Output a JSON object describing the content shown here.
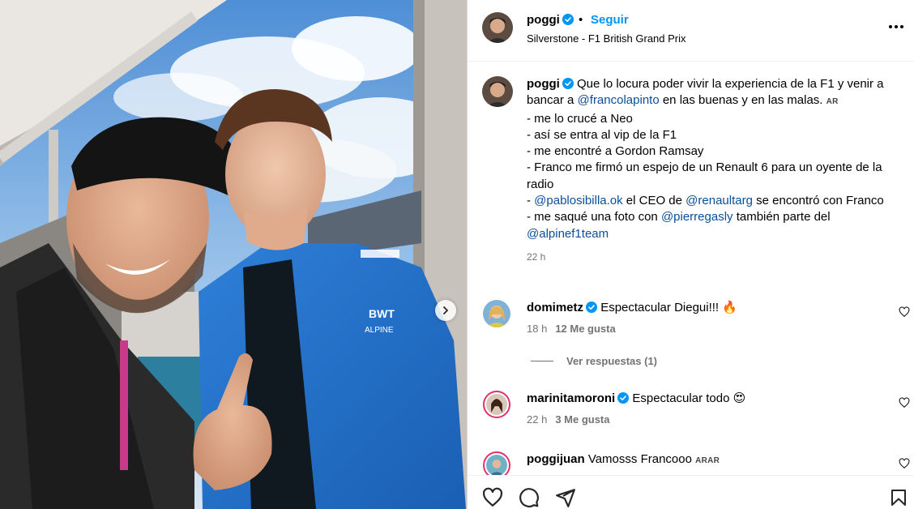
{
  "header": {
    "username": "poggi",
    "follow_label": "Seguir",
    "location": "Silverstone - F1 British Grand Prix",
    "dot": "•"
  },
  "caption": {
    "username": "poggi",
    "line1": "Que lo locura poder vivir la experiencia de la F1 y venir a bancar a ",
    "mention1": "@francolapinto",
    "line1b": " en las buenas y en las malas. ",
    "flag1": "AR",
    "items": [
      "- me lo crucé a Neo",
      "- así se entra al vip de la F1",
      "- me encontré a Gordon Ramsay",
      "- Franco me firmó un espejo de un Renault 6 para un oyente de la radio"
    ],
    "l5_pre": "- ",
    "mention2": "@pablosibilla.ok",
    "l5_mid": " el CEO de ",
    "mention3": "@renaultarg",
    "l5_post": " se encontró con Franco",
    "l6_pre": "- me saqué una foto con ",
    "mention4": "@pierregasly",
    "l6_mid": " también parte del ",
    "mention5": "@alpinef1team",
    "time": "22 h"
  },
  "comments": [
    {
      "username": "domimetz",
      "text": "Espectacular Diegui!!! 🔥",
      "time": "18 h",
      "likes": "12 Me gusta"
    },
    {
      "username": "marinitamoroni",
      "text": "Espectacular todo 😍",
      "time": "22 h",
      "likes": "3 Me gusta"
    },
    {
      "username": "poggijuan",
      "text": "Vamosss Francooo ",
      "flags": "ARAR"
    }
  ],
  "replies_label": "Ver respuestas (1)",
  "colors": {
    "accent": "#0095f6",
    "verified": "#0095f6",
    "mention": "#0a4f9a",
    "muted": "#737373"
  }
}
